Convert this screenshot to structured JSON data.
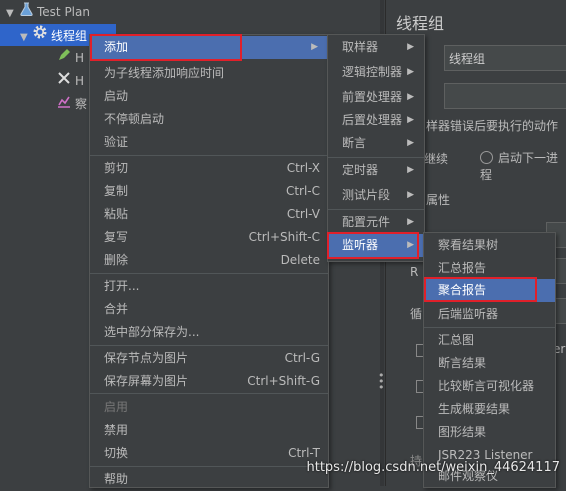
{
  "tree": {
    "items": [
      {
        "label": "Test Plan",
        "icon": "flask-icon"
      },
      {
        "label": "线程组",
        "icon": "gear-icon"
      },
      {
        "label": "H",
        "icon": "pen-icon"
      },
      {
        "label": "H",
        "icon": "tools-icon"
      },
      {
        "label": "察",
        "icon": "chart-icon"
      }
    ]
  },
  "right_panel": {
    "title": "线程组",
    "name_value": "线程组",
    "error_label": "样器错误后要执行的动作",
    "radio_continue": "继续",
    "radio_next": "启动下一进程",
    "props_label": "属性",
    "frag1": "R",
    "frag2": "循",
    "frag3": "era",
    "frag4": "持"
  },
  "menu_main": {
    "items": [
      {
        "label": "添加",
        "shortcut": "",
        "submenu": true,
        "highlighted": true
      },
      {
        "label": "为子线程添加响应时间",
        "shortcut": ""
      },
      {
        "label": "启动",
        "shortcut": ""
      },
      {
        "label": "不停顿启动",
        "shortcut": ""
      },
      {
        "label": "验证",
        "shortcut": ""
      },
      {
        "label": "剪切",
        "shortcut": "Ctrl-X"
      },
      {
        "label": "复制",
        "shortcut": "Ctrl-C"
      },
      {
        "label": "粘贴",
        "shortcut": "Ctrl-V"
      },
      {
        "label": "复写",
        "shortcut": "Ctrl+Shift-C"
      },
      {
        "label": "删除",
        "shortcut": "Delete"
      },
      {
        "label": "打开...",
        "shortcut": ""
      },
      {
        "label": "合并",
        "shortcut": ""
      },
      {
        "label": "选中部分保存为...",
        "shortcut": ""
      },
      {
        "label": "保存节点为图片",
        "shortcut": "Ctrl-G"
      },
      {
        "label": "保存屏幕为图片",
        "shortcut": "Ctrl+Shift-G"
      },
      {
        "label": "启用",
        "shortcut": "",
        "disabled": true
      },
      {
        "label": "禁用",
        "shortcut": ""
      },
      {
        "label": "切换",
        "shortcut": "Ctrl-T"
      },
      {
        "label": "帮助",
        "shortcut": ""
      }
    ]
  },
  "menu_add": {
    "items": [
      {
        "label": "取样器"
      },
      {
        "label": "逻辑控制器"
      },
      {
        "label": "前置处理器"
      },
      {
        "label": "后置处理器"
      },
      {
        "label": "断言"
      },
      {
        "label": "定时器"
      },
      {
        "label": "测试片段"
      },
      {
        "label": "配置元件"
      },
      {
        "label": "监听器",
        "highlighted": true
      }
    ]
  },
  "menu_listener": {
    "items": [
      {
        "label": "察看结果树"
      },
      {
        "label": "汇总报告"
      },
      {
        "label": "聚合报告",
        "highlighted": true
      },
      {
        "label": "后端监听器"
      },
      {
        "label": "汇总图"
      },
      {
        "label": "断言结果"
      },
      {
        "label": "比较断言可视化器"
      },
      {
        "label": "生成概要结果"
      },
      {
        "label": "图形结果"
      },
      {
        "label": "JSR223 Listener"
      },
      {
        "label": "邮件观察仪"
      }
    ]
  },
  "watermark": "https://blog.csdn.net/weixin_44624117",
  "colors": {
    "highlight": "#4b6eaf",
    "annotation_box": "#e0202a",
    "background": "#3c3f41"
  }
}
